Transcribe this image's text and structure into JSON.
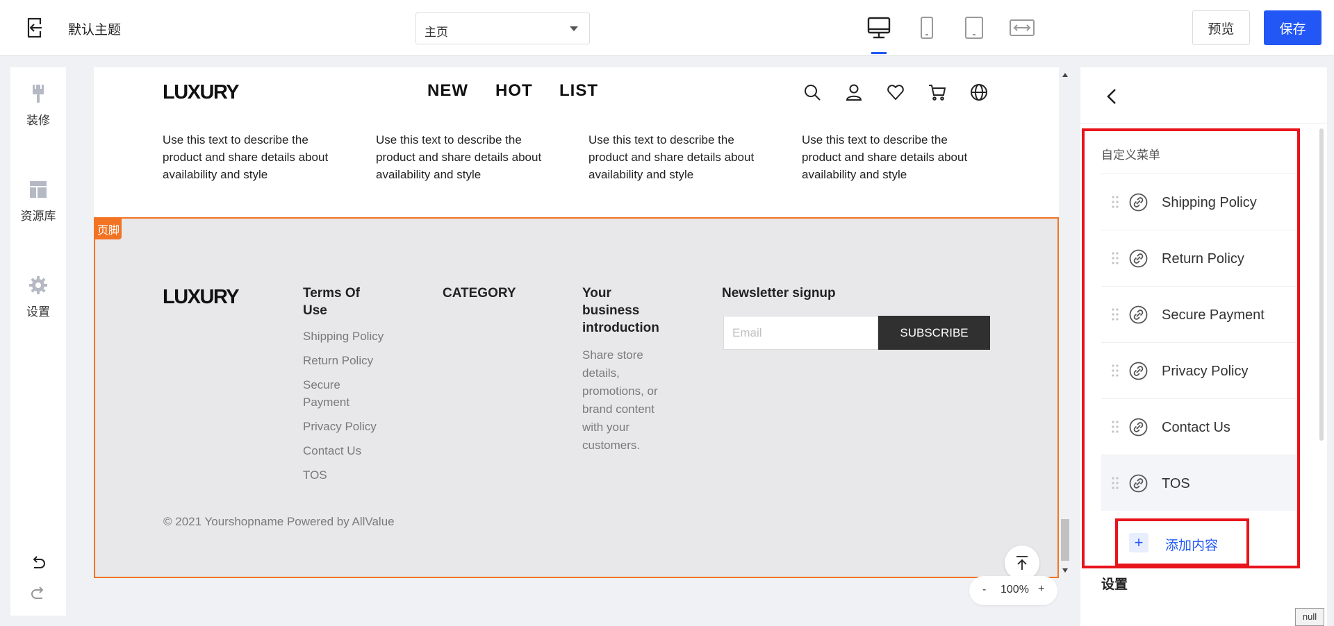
{
  "topbar": {
    "theme_name": "默认主题",
    "page_select": "主页",
    "devices": [
      "desktop-icon",
      "mobile-icon",
      "tablet-icon",
      "full-width-icon"
    ],
    "active_device": "desktop",
    "preview_label": "预览",
    "save_label": "保存",
    "accent": "#2257f5"
  },
  "left_sidebar": {
    "items": [
      {
        "label": "装修",
        "icon": "brush-icon"
      },
      {
        "label": "资源库",
        "icon": "layout-icon"
      },
      {
        "label": "设置",
        "icon": "gear-icon"
      }
    ],
    "undo_icon": "undo-icon",
    "redo_icon": "redo-icon"
  },
  "canvas": {
    "header": {
      "logo": "LUXURY",
      "nav": [
        "NEW",
        "HOT",
        "LIST"
      ],
      "icons": [
        "search-icon",
        "user-icon",
        "heart-icon",
        "cart-icon",
        "globe-icon"
      ]
    },
    "product_desc": [
      "Use this text to describe the product and share details about availability and style",
      "Use this text to describe the product and share details about availability and style",
      "Use this text to describe the product and share details about availability and style",
      "Use this text to describe the product and share details about availability and style"
    ],
    "footer": {
      "tag": "页脚",
      "tag_color": "#f27323",
      "logo": "LUXURY",
      "col1_title_line1": "Terms Of",
      "col1_title_line2": "Use",
      "links": [
        "Shipping Policy",
        "Return Policy",
        "Secure",
        "Payment",
        "Privacy Policy",
        "Contact Us",
        "TOS"
      ],
      "col2_title": "CATEGORY",
      "col3_title_lines": [
        "Your",
        "business",
        "introduction"
      ],
      "col3_text_lines": [
        "Share store",
        "details,",
        "promotions, or",
        "brand content",
        "with your",
        "customers."
      ],
      "newsletter_title": "Newsletter signup",
      "email_placeholder": "Email",
      "subscribe_label": "SUBSCRIBE",
      "copyright": "© 2021 Yourshopname Powered by AllValue"
    },
    "zoom": {
      "minus": "-",
      "level": "100%",
      "plus": "+"
    }
  },
  "right_panel": {
    "menu_title": "自定义菜单",
    "menu_items": [
      "Shipping Policy",
      "Return Policy",
      "Secure Payment",
      "Privacy Policy",
      "Contact Us",
      "TOS"
    ],
    "add_label": "添加内容",
    "settings_label": "设置",
    "highlight_color": "#e8141c"
  },
  "null_label": "null"
}
